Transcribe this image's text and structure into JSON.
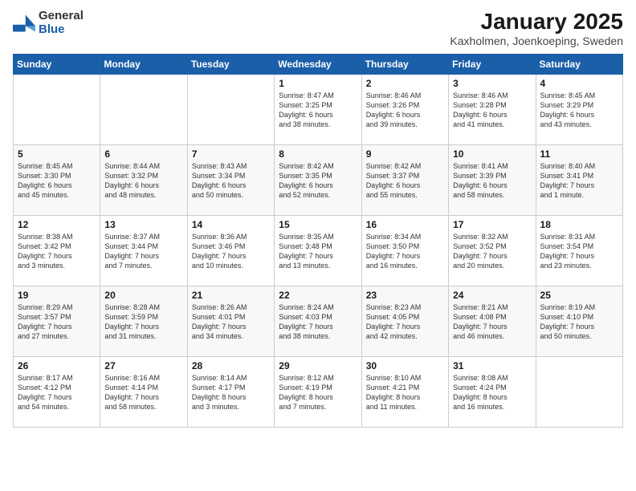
{
  "logo": {
    "general": "General",
    "blue": "Blue"
  },
  "title": {
    "month_year": "January 2025",
    "location": "Kaxholmen, Joenkoeping, Sweden"
  },
  "days_of_week": [
    "Sunday",
    "Monday",
    "Tuesday",
    "Wednesday",
    "Thursday",
    "Friday",
    "Saturday"
  ],
  "weeks": [
    {
      "cells": [
        {
          "day": "",
          "content": ""
        },
        {
          "day": "",
          "content": ""
        },
        {
          "day": "",
          "content": ""
        },
        {
          "day": "1",
          "content": "Sunrise: 8:47 AM\nSunset: 3:25 PM\nDaylight: 6 hours\nand 38 minutes."
        },
        {
          "day": "2",
          "content": "Sunrise: 8:46 AM\nSunset: 3:26 PM\nDaylight: 6 hours\nand 39 minutes."
        },
        {
          "day": "3",
          "content": "Sunrise: 8:46 AM\nSunset: 3:28 PM\nDaylight: 6 hours\nand 41 minutes."
        },
        {
          "day": "4",
          "content": "Sunrise: 8:45 AM\nSunset: 3:29 PM\nDaylight: 6 hours\nand 43 minutes."
        }
      ]
    },
    {
      "cells": [
        {
          "day": "5",
          "content": "Sunrise: 8:45 AM\nSunset: 3:30 PM\nDaylight: 6 hours\nand 45 minutes."
        },
        {
          "day": "6",
          "content": "Sunrise: 8:44 AM\nSunset: 3:32 PM\nDaylight: 6 hours\nand 48 minutes."
        },
        {
          "day": "7",
          "content": "Sunrise: 8:43 AM\nSunset: 3:34 PM\nDaylight: 6 hours\nand 50 minutes."
        },
        {
          "day": "8",
          "content": "Sunrise: 8:42 AM\nSunset: 3:35 PM\nDaylight: 6 hours\nand 52 minutes."
        },
        {
          "day": "9",
          "content": "Sunrise: 8:42 AM\nSunset: 3:37 PM\nDaylight: 6 hours\nand 55 minutes."
        },
        {
          "day": "10",
          "content": "Sunrise: 8:41 AM\nSunset: 3:39 PM\nDaylight: 6 hours\nand 58 minutes."
        },
        {
          "day": "11",
          "content": "Sunrise: 8:40 AM\nSunset: 3:41 PM\nDaylight: 7 hours\nand 1 minute."
        }
      ]
    },
    {
      "cells": [
        {
          "day": "12",
          "content": "Sunrise: 8:38 AM\nSunset: 3:42 PM\nDaylight: 7 hours\nand 3 minutes."
        },
        {
          "day": "13",
          "content": "Sunrise: 8:37 AM\nSunset: 3:44 PM\nDaylight: 7 hours\nand 7 minutes."
        },
        {
          "day": "14",
          "content": "Sunrise: 8:36 AM\nSunset: 3:46 PM\nDaylight: 7 hours\nand 10 minutes."
        },
        {
          "day": "15",
          "content": "Sunrise: 8:35 AM\nSunset: 3:48 PM\nDaylight: 7 hours\nand 13 minutes."
        },
        {
          "day": "16",
          "content": "Sunrise: 8:34 AM\nSunset: 3:50 PM\nDaylight: 7 hours\nand 16 minutes."
        },
        {
          "day": "17",
          "content": "Sunrise: 8:32 AM\nSunset: 3:52 PM\nDaylight: 7 hours\nand 20 minutes."
        },
        {
          "day": "18",
          "content": "Sunrise: 8:31 AM\nSunset: 3:54 PM\nDaylight: 7 hours\nand 23 minutes."
        }
      ]
    },
    {
      "cells": [
        {
          "day": "19",
          "content": "Sunrise: 8:29 AM\nSunset: 3:57 PM\nDaylight: 7 hours\nand 27 minutes."
        },
        {
          "day": "20",
          "content": "Sunrise: 8:28 AM\nSunset: 3:59 PM\nDaylight: 7 hours\nand 31 minutes."
        },
        {
          "day": "21",
          "content": "Sunrise: 8:26 AM\nSunset: 4:01 PM\nDaylight: 7 hours\nand 34 minutes."
        },
        {
          "day": "22",
          "content": "Sunrise: 8:24 AM\nSunset: 4:03 PM\nDaylight: 7 hours\nand 38 minutes."
        },
        {
          "day": "23",
          "content": "Sunrise: 8:23 AM\nSunset: 4:05 PM\nDaylight: 7 hours\nand 42 minutes."
        },
        {
          "day": "24",
          "content": "Sunrise: 8:21 AM\nSunset: 4:08 PM\nDaylight: 7 hours\nand 46 minutes."
        },
        {
          "day": "25",
          "content": "Sunrise: 8:19 AM\nSunset: 4:10 PM\nDaylight: 7 hours\nand 50 minutes."
        }
      ]
    },
    {
      "cells": [
        {
          "day": "26",
          "content": "Sunrise: 8:17 AM\nSunset: 4:12 PM\nDaylight: 7 hours\nand 54 minutes."
        },
        {
          "day": "27",
          "content": "Sunrise: 8:16 AM\nSunset: 4:14 PM\nDaylight: 7 hours\nand 58 minutes."
        },
        {
          "day": "28",
          "content": "Sunrise: 8:14 AM\nSunset: 4:17 PM\nDaylight: 8 hours\nand 3 minutes."
        },
        {
          "day": "29",
          "content": "Sunrise: 8:12 AM\nSunset: 4:19 PM\nDaylight: 8 hours\nand 7 minutes."
        },
        {
          "day": "30",
          "content": "Sunrise: 8:10 AM\nSunset: 4:21 PM\nDaylight: 8 hours\nand 11 minutes."
        },
        {
          "day": "31",
          "content": "Sunrise: 8:08 AM\nSunset: 4:24 PM\nDaylight: 8 hours\nand 16 minutes."
        },
        {
          "day": "",
          "content": ""
        }
      ]
    }
  ]
}
